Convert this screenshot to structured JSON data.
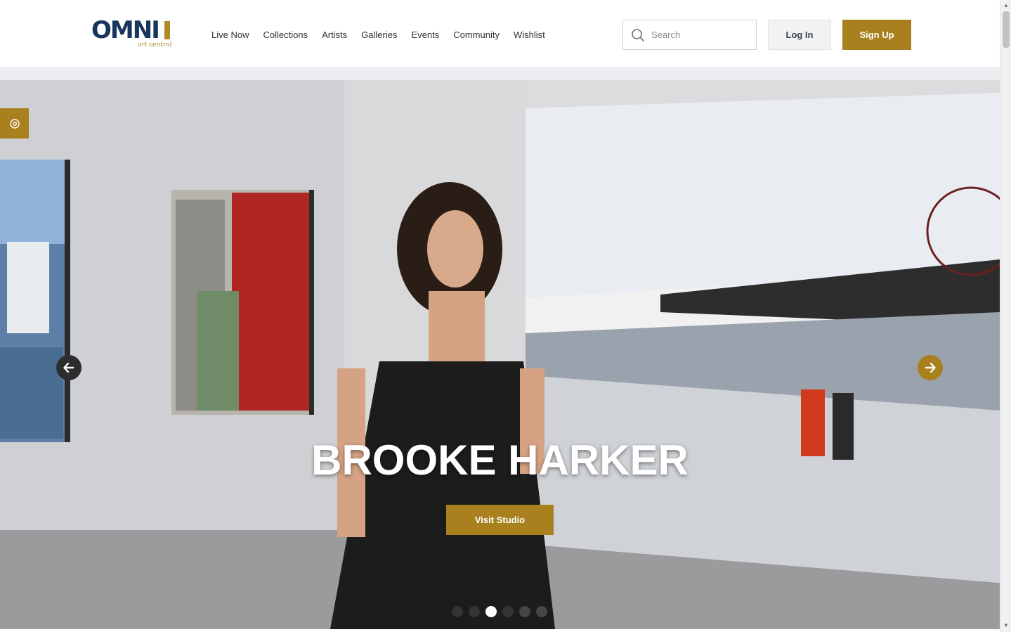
{
  "brand": {
    "logo_word": "OMNI",
    "logo_sub": "art central",
    "accent_color": "#a8801e",
    "navy_color": "#17365d"
  },
  "nav": {
    "items": [
      "Live Now",
      "Collections",
      "Artists",
      "Galleries",
      "Events",
      "Community",
      "Wishlist"
    ]
  },
  "search": {
    "placeholder": "Search",
    "value": ""
  },
  "auth": {
    "login_label": "Log In",
    "signup_label": "Sign Up"
  },
  "hero": {
    "title": "BROOKE HARKER",
    "cta_label": "Visit Studio",
    "slide_count": 6,
    "active_slide": 3,
    "icons": {
      "settings": "settings-icon",
      "prev": "arrow-left-icon",
      "next": "arrow-right-icon"
    }
  },
  "scrollbar": {
    "up_glyph": "▲",
    "down_glyph": "▼"
  }
}
